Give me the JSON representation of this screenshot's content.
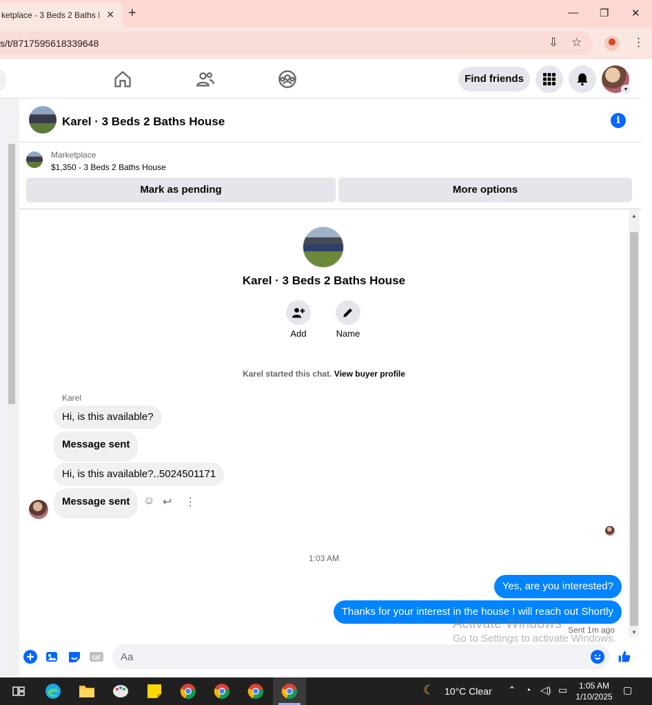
{
  "browser": {
    "tab_title": "ketplace - 3 Beds 2 Baths H",
    "url": "s/t/8717595618339648"
  },
  "nav": {
    "find_friends": "Find friends"
  },
  "chat": {
    "title": "Karel · 3 Beds 2 Baths House"
  },
  "marketplace": {
    "label": "Marketplace",
    "listing": "$1,350 - 3 Beds 2 Baths House",
    "mark_pending": "Mark as pending",
    "more_options": "More options"
  },
  "conversation": {
    "title": "Karel · 3 Beds 2 Baths House",
    "add_label": "Add",
    "name_label": "Name",
    "started_text": "Karel started this chat.",
    "view_profile": "View buyer profile",
    "sender": "Karel",
    "incoming": [
      "Hi, is this available?",
      "Message sent",
      "Hi, is this available?..5024501171",
      "Message sent"
    ],
    "timestamp": "1:03 AM",
    "outgoing": [
      "Yes, are you interested?",
      "Thanks for your interest in the house I will reach out Shortly"
    ],
    "sent_status": "Sent 1m ago"
  },
  "composer": {
    "placeholder": "Aa"
  },
  "watermark": {
    "line1": "Activate Windows",
    "line2": "Go to Settings to activate Windows."
  },
  "taskbar": {
    "weather": "10°C  Clear",
    "time": "1:05 AM",
    "date": "1/10/2025"
  },
  "colors": {
    "messenger_blue": "#0084ff",
    "fb_blue": "#0866ff",
    "tab_strip": "#fbd9d2"
  }
}
